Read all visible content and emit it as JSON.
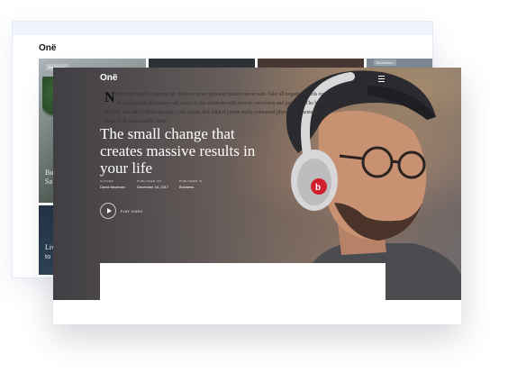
{
  "back": {
    "logo": "Onë",
    "tiles": [
      {
        "tag": "Business",
        "title": "Bu\nSa"
      },
      {
        "tag": "",
        "title": ""
      },
      {
        "tag": "",
        "title": ""
      },
      {
        "tag": "Business",
        "title": ""
      },
      {
        "tag": "",
        "title": "Liv\nto"
      }
    ]
  },
  "front": {
    "logo": "Onë",
    "hero": {
      "title": "The small change that creates massive results in your life",
      "meta": {
        "author_label": "AUTHOR",
        "author": "David Beckham",
        "date_label": "PUBLISHED ON",
        "date": "December 16, 2017",
        "category_label": "PUBLISHED IN",
        "category": "Business"
      },
      "play_label": "PLAY VIDEO"
    },
    "article": {
      "dropcap": "N",
      "text": "ever ever think of giving up. Winners never quit and quitters never win. Take all negative words out of your mental dictionary and focus on the solutions with utmost conviction and patience. The battle is never lost until you've abandon your vision. But what if you're really exhausted physically, mentally, and most of all emotionally? Here"
    }
  }
}
